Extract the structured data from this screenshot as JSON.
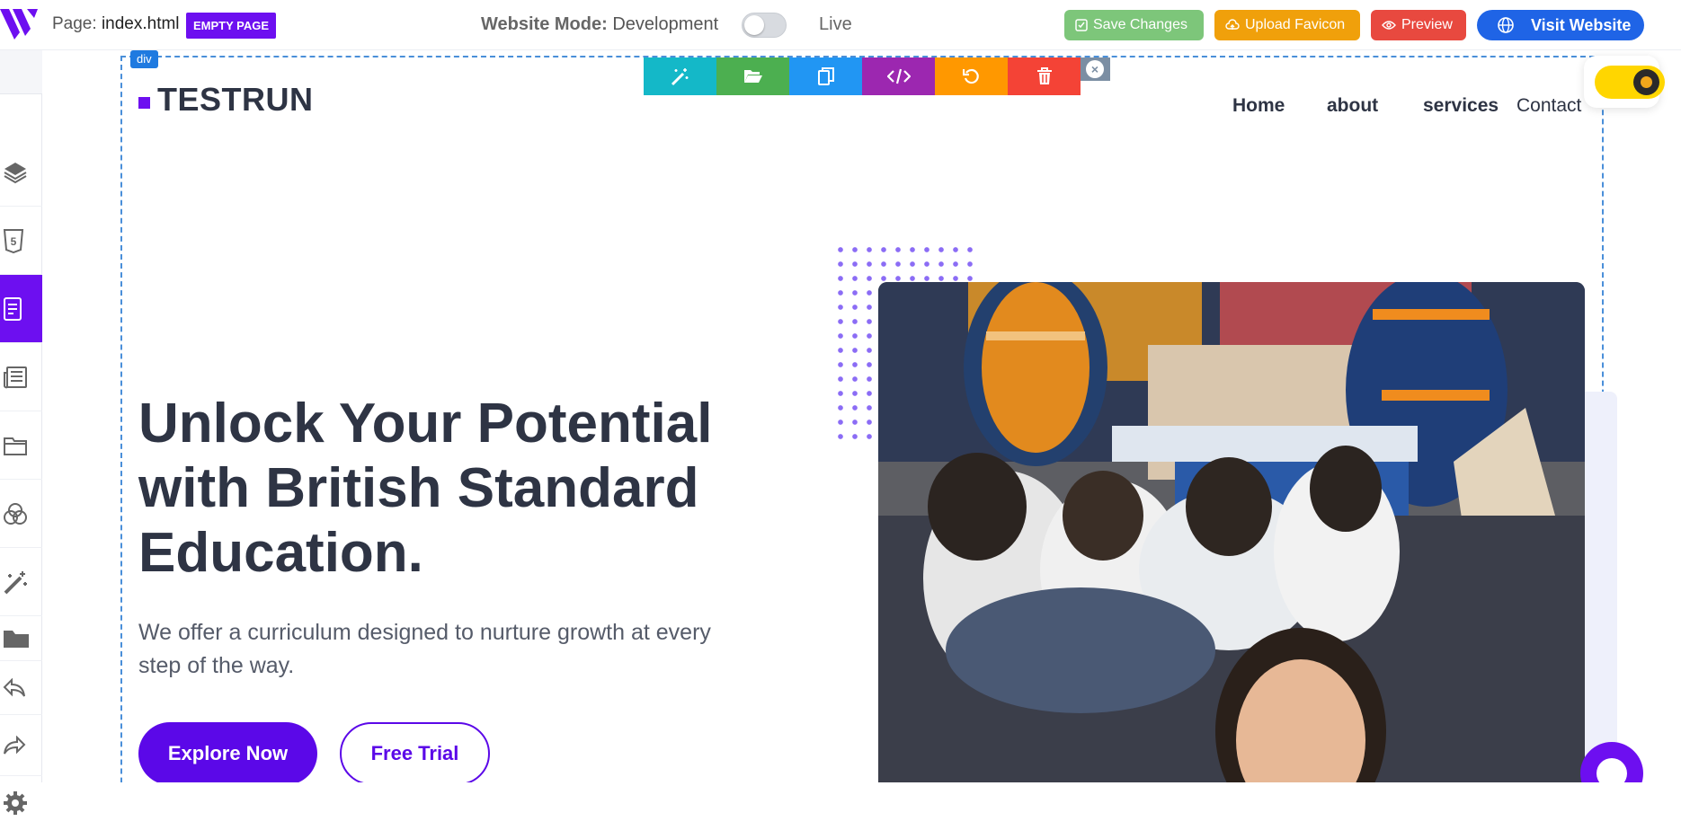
{
  "topbar": {
    "page_prefix": "Page:",
    "page_name": "index.html",
    "empty_badge": "EMPTY PAGE",
    "mode_label": "Website Mode:",
    "mode_value": "Development",
    "live_label": "Live",
    "save_label": "Save Changes",
    "favicon_label": "Upload Favicon",
    "preview_label": "Preview",
    "visit_label": "Visit Website"
  },
  "colors": {
    "accent": "#6d0ff0",
    "save": "#7dc67a",
    "favicon": "#f0a00b",
    "preview": "#e8493f",
    "visit": "#1f64e6"
  },
  "sidebar": {
    "items": [
      {
        "icon": "layers-icon"
      },
      {
        "icon": "html5-icon"
      },
      {
        "icon": "page-icon",
        "active": true
      },
      {
        "icon": "newspaper-icon"
      },
      {
        "icon": "folder-outline-icon"
      },
      {
        "icon": "circles-icon"
      },
      {
        "icon": "magic-wand-icon"
      },
      {
        "icon": "folder-solid-icon"
      },
      {
        "icon": "undo-icon"
      },
      {
        "icon": "redo-icon"
      },
      {
        "icon": "gear-icon"
      }
    ]
  },
  "canvas": {
    "selected_tag": "div",
    "edit_toolbar": [
      {
        "icon": "magic-wand-icon",
        "color": "#14b8c8"
      },
      {
        "icon": "folder-open-icon",
        "color": "#4caf50"
      },
      {
        "icon": "copy-icon",
        "color": "#2196f3"
      },
      {
        "icon": "code-icon",
        "color": "#9c27b0"
      },
      {
        "icon": "undo-icon",
        "color": "#ff9800"
      },
      {
        "icon": "trash-icon",
        "color": "#f44336"
      }
    ],
    "close_glyph": "×"
  },
  "site": {
    "brand": "TESTRUN",
    "nav": [
      "Home",
      "about",
      "services",
      "Contact"
    ],
    "headline": "Unlock Your Potential with British Standard Education.",
    "subtext": "We offer a curriculum designed to nurture growth at every step of the way.",
    "primary_cta": "Explore Now",
    "secondary_cta": "Free Trial"
  }
}
